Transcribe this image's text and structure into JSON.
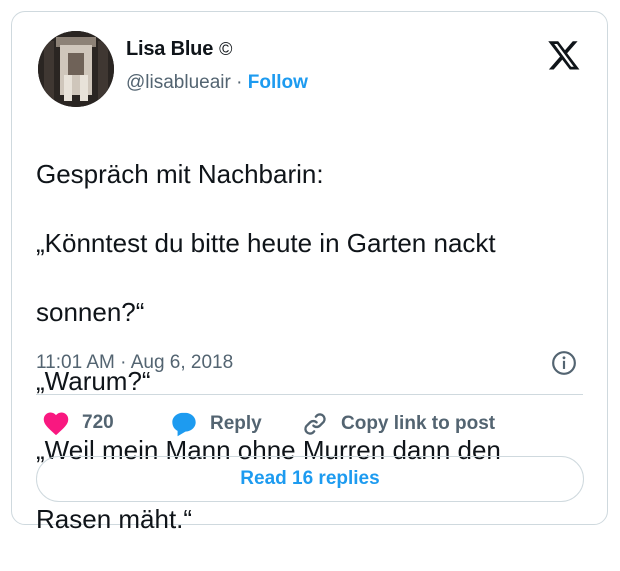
{
  "author": {
    "name": "Lisa Blue",
    "name_mark": "©",
    "handle": "@lisablueair",
    "separator": "·",
    "follow_label": "Follow"
  },
  "tweet": {
    "lines": [
      "Gespräch mit Nachbarin:",
      "„Könntest du bitte heute in Garten nackt",
      "sonnen?“",
      "„Warum?“",
      "„Weil mein Mann ohne Murren dann den",
      "Rasen mäht.“"
    ],
    "timestamp": "11:01 AM · Aug 6, 2018"
  },
  "actions": {
    "like_count": "720",
    "reply_label": "Reply",
    "copy_label": "Copy link to post"
  },
  "read_replies_label": "Read 16 replies",
  "colors": {
    "accent": "#1d9bf0",
    "like": "#f91880",
    "muted": "#536471",
    "border": "#cfd9de"
  },
  "icons": [
    "x-logo-icon",
    "info-icon",
    "heart-icon",
    "reply-bubble-icon",
    "link-icon"
  ]
}
